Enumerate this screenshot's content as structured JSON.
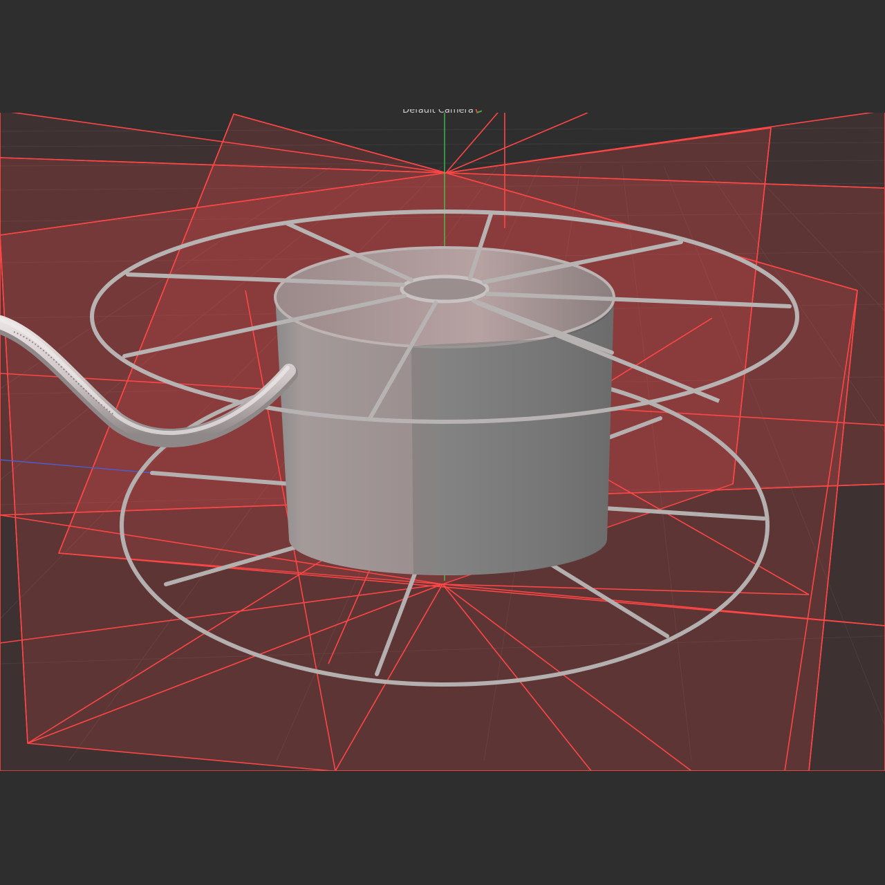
{
  "viewport": {
    "camera_label": "Default Camera",
    "camera_icon": "camera-axes-icon",
    "background_color": "#2e2e2e",
    "grid_color": "#3c3c3c",
    "plane_fill_color": "#d24b4b",
    "plane_edge_color": "#ff4646",
    "model_color": "#9a9a9a",
    "axis_y_color": "#3fd84f",
    "axis_z_color": "#4a5fd0"
  }
}
